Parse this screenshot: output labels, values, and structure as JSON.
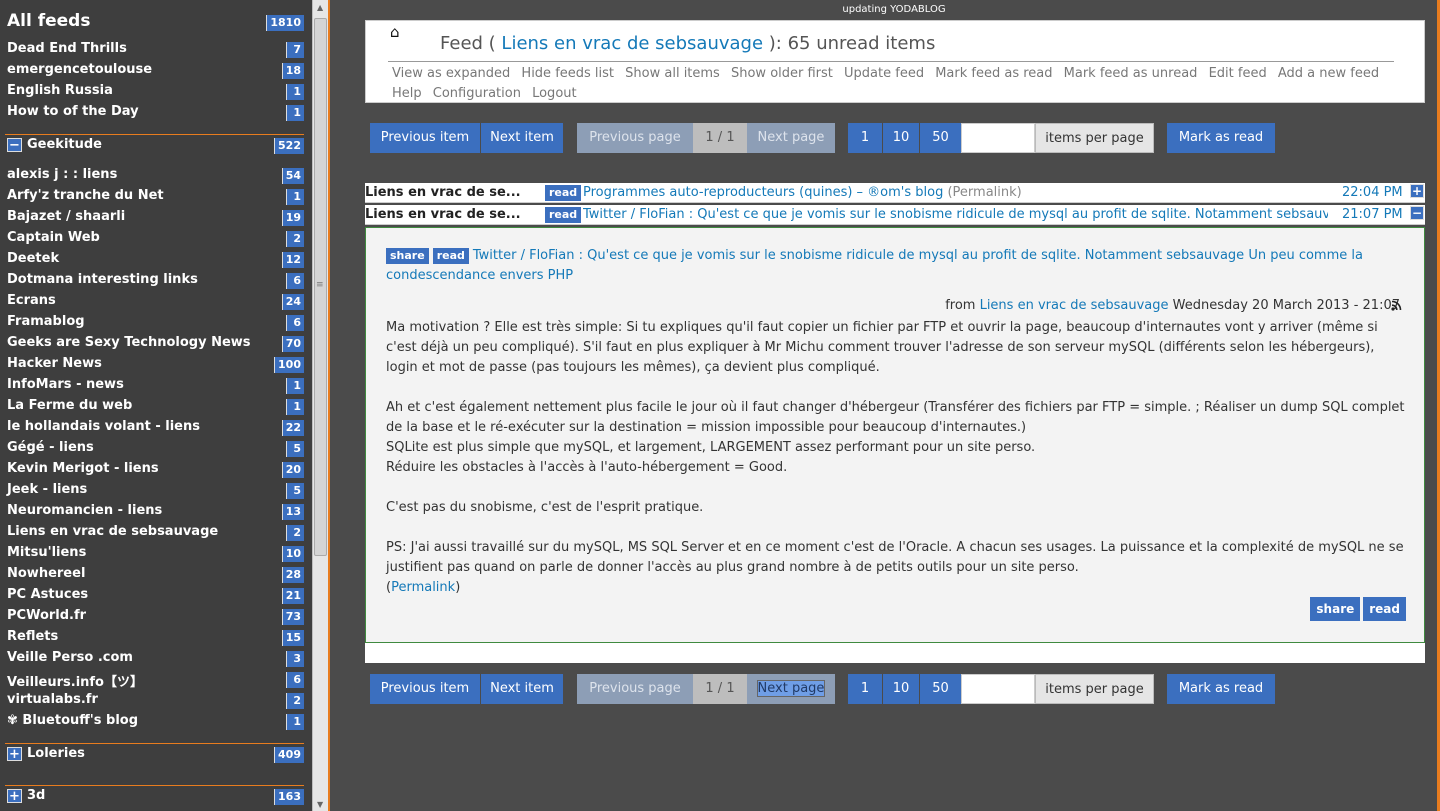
{
  "status": "updating YODABLOG",
  "sidebar": {
    "all": {
      "label": "All feeds",
      "count": "1810"
    },
    "feeds_top": [
      {
        "label": "Dead End Thrills",
        "count": "7"
      },
      {
        "label": "emergencetoulouse",
        "count": "18"
      },
      {
        "label": "English Russia",
        "count": "1"
      },
      {
        "label": "How to of the Day",
        "count": "1"
      }
    ],
    "cat_geek": {
      "icon": "minus-icon",
      "sign": "−",
      "label": "Geekitude",
      "count": "522"
    },
    "feeds_geek": [
      {
        "label": "alexis j : : liens",
        "count": "54"
      },
      {
        "label": "Arfy'z tranche du Net",
        "count": "1"
      },
      {
        "label": "Bajazet / shaarli",
        "count": "19"
      },
      {
        "label": "Captain Web",
        "count": "2"
      },
      {
        "label": "Deetek",
        "count": "12"
      },
      {
        "label": "Dotmana interesting links",
        "count": "6"
      },
      {
        "label": "Ecrans",
        "count": "24"
      },
      {
        "label": "Framablog",
        "count": "6"
      },
      {
        "label": "Geeks are Sexy Technology News",
        "count": "70"
      },
      {
        "label": "Hacker News",
        "count": "100"
      },
      {
        "label": "InfoMars - news",
        "count": "1"
      },
      {
        "label": "La Ferme du web",
        "count": "1"
      },
      {
        "label": "le hollandais volant - liens",
        "count": "22"
      },
      {
        "label": "Gégé - liens",
        "count": "5"
      },
      {
        "label": "Kevin Merigot - liens",
        "count": "20"
      },
      {
        "label": "Jeek - liens",
        "count": "5"
      },
      {
        "label": "Neuromancien - liens",
        "count": "13"
      },
      {
        "label": "Liens en vrac de sebsauvage",
        "count": "2"
      },
      {
        "label": "Mitsu'liens",
        "count": "10"
      },
      {
        "label": "Nowhereel",
        "count": "28"
      },
      {
        "label": "PC Astuces",
        "count": "21"
      },
      {
        "label": "PCWorld.fr",
        "count": "73"
      },
      {
        "label": "Reflets",
        "count": "15"
      },
      {
        "label": "Veille Perso .com",
        "count": "3"
      },
      {
        "label": "Veilleurs.info【ツ】",
        "count": "6"
      },
      {
        "label": "virtualabs.fr",
        "count": "2"
      },
      {
        "label": "✾ Bluetouff's blog",
        "count": "1"
      }
    ],
    "cat_lol": {
      "icon": "plus-icon",
      "sign": "+",
      "label": "Loleries",
      "count": "409"
    },
    "cat_3d": {
      "icon": "plus-icon",
      "sign": "+",
      "label": "3d",
      "count": "163"
    }
  },
  "header": {
    "home_icon": "home-icon",
    "home_glyph": "⌂",
    "title_pre": "Feed ( ",
    "feed_name": "Liens en vrac de sebsauvage",
    "title_post": " ): 65 unread items",
    "menu": [
      "View as expanded",
      "Hide feeds list",
      "Show all items",
      "Show older first",
      "Update feed",
      "Mark feed as read",
      "Mark feed as unread",
      "Edit feed",
      "Add a new feed",
      "Help",
      "Configuration",
      "Logout"
    ]
  },
  "nav": {
    "prev_item": "Previous item",
    "next_item": "Next item",
    "prev_page": "Previous page",
    "page": "1 / 1",
    "next_page": "Next page",
    "n1": "1",
    "n10": "10",
    "n50": "50",
    "per_page": "items per page",
    "mark_read": "Mark as read"
  },
  "items": [
    {
      "source": "Liens en vrac de se...",
      "tag": "read",
      "title": "Programmes auto-reproducteurs (quines) – ®om's blog",
      "perm": "(Permalink)",
      "time": "22:04 PM",
      "toggle": "+"
    },
    {
      "source": "Liens en vrac de se...",
      "tag": "read",
      "title": "Twitter / FloFian : Qu'est ce que je vomis sur le snobisme ridicule de mysql au profit de sqlite. Notamment sebsauvage ...",
      "perm": "",
      "time": "21:07 PM",
      "toggle": "−"
    }
  ],
  "article": {
    "share": "share",
    "read": "read",
    "title": "Twitter / FloFian : Qu'est ce que je vomis sur le snobisme ridicule de mysql au profit de sqlite. Notamment sebsauvage Un peu comme la condescendance envers PHP",
    "from": "from ",
    "from_feed": "Liens en vrac de sebsauvage",
    "date": " Wednesday 20 March 2013 - 21:07",
    "rss_icon": "rss-icon",
    "p1": "Ma motivation ? Elle est très simple: Si tu expliques qu'il faut copier un fichier par FTP et ouvrir la page, beaucoup d'internautes vont y arriver (même si c'est déjà un peu compliqué). S'il faut en plus expliquer à Mr Michu comment trouver l'adresse de son serveur mySQL (différents selon les hébergeurs), login et mot de passe (pas toujours les mêmes), ça devient plus compliqué.",
    "p2": "Ah et c'est également nettement plus facile le jour où il faut changer d'hébergeur (Transférer des fichiers par FTP = simple. ; Réaliser un dump SQL complet de la base et le ré-exécuter sur la destination = mission impossible pour beaucoup d'internautes.)",
    "p3": "SQLite est plus simple que mySQL, et largement, LARGEMENT assez performant pour un site perso.",
    "p4": "Réduire les obstacles à l'accès à l'auto-hébergement = Good.",
    "p5": "C'est pas du snobisme, c'est de l'esprit pratique.",
    "p6": "PS: J'ai aussi travaillé sur du mySQL, MS SQL Server et en ce moment c'est de l'Oracle. A chacun ses usages. La puissance et la complexité de mySQL ne se justifient pas quand on parle de donner l'accès au plus grand nombre à de petits outils pour un site perso.",
    "perm_open": "(",
    "permalink": "Permalink",
    "perm_close": ")"
  }
}
